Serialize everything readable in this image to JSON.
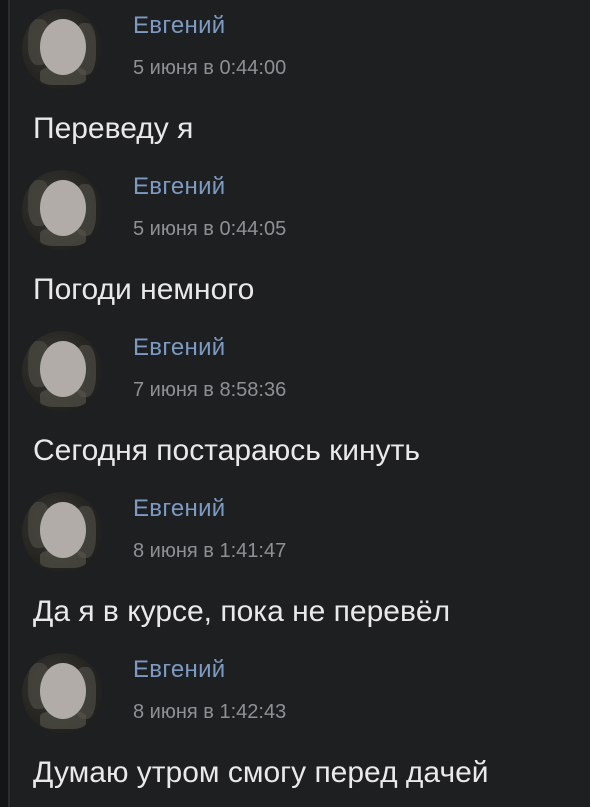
{
  "messages": [
    {
      "sender": "Евгений",
      "time": "5 июня в 0:44:00",
      "text": "Переведу я"
    },
    {
      "sender": "Евгений",
      "time": "5 июня в 0:44:05",
      "text": "Погоди немного"
    },
    {
      "sender": "Евгений",
      "time": "7 июня в 8:58:36",
      "text": "Сегодня постараюсь кинуть"
    },
    {
      "sender": "Евгений",
      "time": "8 июня в 1:41:47",
      "text": "Да я в курсе, пока не перевёл"
    },
    {
      "sender": "Евгений",
      "time": "8 июня в 1:42:43",
      "text": "Думаю утром смогу перед дачей"
    }
  ],
  "colors": {
    "background": "#1e1f21",
    "sender_name": "#7c9ac2",
    "timestamp": "#8e9094",
    "message_text": "#e9e9ea"
  },
  "icons": {
    "avatar": "avatar-icon"
  }
}
